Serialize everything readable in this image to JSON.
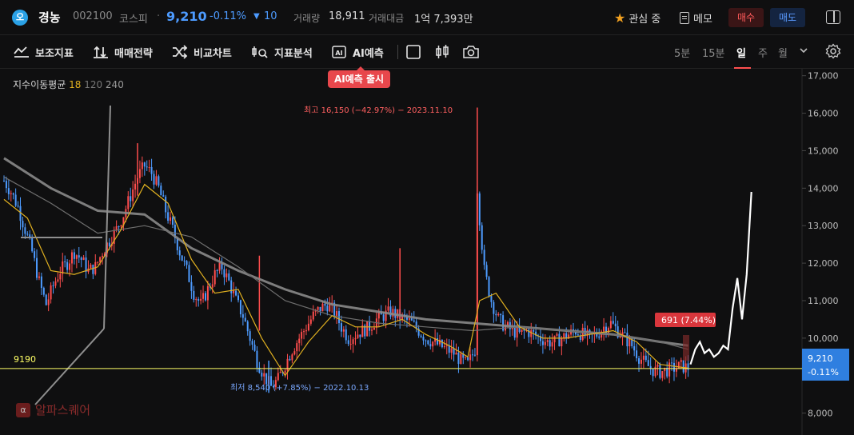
{
  "header": {
    "logo_glyph": "오",
    "name": "경농",
    "code": "002100",
    "market": "코스피",
    "dot": "·",
    "price": "9,210",
    "change_pct": "-0.11%",
    "change_arrow": "▼",
    "change_amt": "10",
    "volume_label": "거래량",
    "volume_value": "18,911",
    "tvalue_label": "거래대금",
    "tvalue_value": "1억 7,393만",
    "watch_label": "관심 중",
    "memo_label": "메모",
    "buy_label": "매수",
    "sell_label": "매도"
  },
  "toolbar": {
    "indicators": "보조지표",
    "strategy": "매매전략",
    "compare": "비교차트",
    "analysis": "지표분석",
    "ai_icon_text": "AI",
    "ai": "AI예측",
    "periods": [
      "5분",
      "15분",
      "일",
      "주",
      "월"
    ],
    "active_period": "일",
    "badge": "AI예측 출시"
  },
  "legend": {
    "label": "지수이동평균",
    "p1": "18",
    "p2": "120",
    "p3": "240"
  },
  "watermark": {
    "logo": "α",
    "text": "알파스퀘어"
  },
  "colors": {
    "up": "#ff4d4d",
    "down": "#4d9bff",
    "ma18": "#e0b020",
    "ma120": "#6e6e6e",
    "ma240": "#8a8a8a",
    "current_line": "#ffff66",
    "price_tag_bg": "#2f7fe0"
  },
  "chart_data": {
    "type": "candlestick",
    "ylim": [
      7800,
      17100
    ],
    "yticks": [
      "17,000",
      "16,000",
      "15,000",
      "14,000",
      "13,000",
      "12,000",
      "11,000",
      "10,000",
      "9,000",
      "8,000"
    ],
    "ytick_values": [
      17000,
      16000,
      15000,
      14000,
      13000,
      12000,
      11000,
      10000,
      9000,
      8000
    ],
    "current_price": 9210,
    "current_price_label": "9,210",
    "current_change_label": "-0.11%",
    "level_line": 9190,
    "level_line_label": "9190",
    "high_annotation": "최고 16,150 (−42.97%) − 2023.11.10",
    "low_annotation": "최저 8,540 (+7.85%) − 2022.10.13",
    "projection_label": "691  (7.44%)",
    "price_path": [
      [
        0,
        14200
      ],
      [
        3,
        13900
      ],
      [
        6,
        13500
      ],
      [
        9,
        12900
      ],
      [
        12,
        12300
      ],
      [
        15,
        11500
      ],
      [
        18,
        10900
      ],
      [
        21,
        11400
      ],
      [
        24,
        11800
      ],
      [
        27,
        12000
      ],
      [
        30,
        12300
      ],
      [
        33,
        12100
      ],
      [
        36,
        11800
      ],
      [
        39,
        11900
      ],
      [
        42,
        12300
      ],
      [
        45,
        12600
      ],
      [
        48,
        12900
      ],
      [
        51,
        13300
      ],
      [
        54,
        13800
      ],
      [
        57,
        14300
      ],
      [
        60,
        14600
      ],
      [
        63,
        14400
      ],
      [
        66,
        14000
      ],
      [
        69,
        13400
      ],
      [
        72,
        12900
      ],
      [
        75,
        12300
      ],
      [
        78,
        11800
      ],
      [
        81,
        11200
      ],
      [
        84,
        10900
      ],
      [
        87,
        11300
      ],
      [
        90,
        11700
      ],
      [
        93,
        11900
      ],
      [
        96,
        11500
      ],
      [
        99,
        11000
      ],
      [
        102,
        10600
      ],
      [
        105,
        10000
      ],
      [
        108,
        9400
      ],
      [
        111,
        9000
      ],
      [
        114,
        8700
      ],
      [
        117,
        8900
      ],
      [
        120,
        9300
      ],
      [
        123,
        9700
      ],
      [
        126,
        10000
      ],
      [
        129,
        10300
      ],
      [
        132,
        10600
      ],
      [
        135,
        10800
      ],
      [
        138,
        10900
      ],
      [
        141,
        10700
      ],
      [
        144,
        10300
      ],
      [
        147,
        10000
      ],
      [
        150,
        10100
      ],
      [
        153,
        10200
      ],
      [
        156,
        10300
      ],
      [
        159,
        10500
      ],
      [
        162,
        10600
      ],
      [
        165,
        10700
      ],
      [
        168,
        10600
      ],
      [
        171,
        10500
      ],
      [
        174,
        10400
      ],
      [
        177,
        10200
      ],
      [
        180,
        10000
      ],
      [
        183,
        9900
      ],
      [
        186,
        9800
      ],
      [
        189,
        9700
      ],
      [
        192,
        9600
      ],
      [
        195,
        9400
      ],
      [
        198,
        9300
      ],
      [
        201,
        9700
      ],
      [
        202,
        14000
      ],
      [
        203,
        13200
      ],
      [
        205,
        11800
      ],
      [
        208,
        11000
      ],
      [
        211,
        10500
      ],
      [
        214,
        10300
      ],
      [
        217,
        10200
      ],
      [
        220,
        10100
      ],
      [
        223,
        10200
      ],
      [
        226,
        10100
      ],
      [
        229,
        10000
      ],
      [
        232,
        9900
      ],
      [
        235,
        9900
      ],
      [
        238,
        10000
      ],
      [
        241,
        10100
      ],
      [
        244,
        10200
      ],
      [
        247,
        10100
      ],
      [
        250,
        10000
      ],
      [
        253,
        10100
      ],
      [
        256,
        10300
      ],
      [
        259,
        10400
      ],
      [
        262,
        10200
      ],
      [
        265,
        10000
      ],
      [
        268,
        9800
      ],
      [
        271,
        9500
      ],
      [
        274,
        9300
      ],
      [
        277,
        9150
      ],
      [
        280,
        9100
      ],
      [
        283,
        9150
      ],
      [
        286,
        9200
      ],
      [
        289,
        9250
      ],
      [
        292,
        9210
      ]
    ],
    "ma18_path": [
      [
        0,
        13700
      ],
      [
        10,
        13200
      ],
      [
        20,
        11800
      ],
      [
        30,
        11700
      ],
      [
        40,
        11900
      ],
      [
        50,
        12900
      ],
      [
        60,
        14100
      ],
      [
        70,
        13600
      ],
      [
        80,
        12100
      ],
      [
        90,
        11200
      ],
      [
        100,
        11300
      ],
      [
        110,
        10000
      ],
      [
        120,
        9000
      ],
      [
        130,
        9900
      ],
      [
        140,
        10600
      ],
      [
        150,
        10300
      ],
      [
        160,
        10300
      ],
      [
        170,
        10500
      ],
      [
        180,
        10100
      ],
      [
        190,
        9800
      ],
      [
        198,
        9500
      ],
      [
        203,
        11000
      ],
      [
        210,
        11200
      ],
      [
        220,
        10300
      ],
      [
        230,
        10000
      ],
      [
        240,
        10000
      ],
      [
        250,
        10100
      ],
      [
        260,
        10200
      ],
      [
        270,
        9900
      ],
      [
        280,
        9300
      ],
      [
        292,
        9200
      ]
    ],
    "ma120_path": [
      [
        0,
        14300
      ],
      [
        20,
        13600
      ],
      [
        40,
        12800
      ],
      [
        60,
        13000
      ],
      [
        80,
        12700
      ],
      [
        100,
        11900
      ],
      [
        120,
        11000
      ],
      [
        140,
        10600
      ],
      [
        160,
        10400
      ],
      [
        180,
        10300
      ],
      [
        200,
        10200
      ],
      [
        220,
        10300
      ],
      [
        240,
        10200
      ],
      [
        260,
        10100
      ],
      [
        280,
        9900
      ],
      [
        292,
        9700
      ]
    ],
    "ma240_path": [
      [
        0,
        14800
      ],
      [
        20,
        14000
      ],
      [
        40,
        13400
      ],
      [
        60,
        13300
      ],
      [
        80,
        12400
      ],
      [
        100,
        11800
      ],
      [
        120,
        11300
      ],
      [
        140,
        10900
      ],
      [
        160,
        10700
      ],
      [
        180,
        10500
      ],
      [
        200,
        10400
      ],
      [
        220,
        10300
      ],
      [
        240,
        10200
      ],
      [
        260,
        10100
      ],
      [
        280,
        9900
      ],
      [
        292,
        9800
      ]
    ],
    "forecast_path": [
      [
        293,
        9300
      ],
      [
        295,
        9700
      ],
      [
        297,
        9900
      ],
      [
        299,
        9600
      ],
      [
        301,
        9700
      ],
      [
        303,
        9500
      ],
      [
        305,
        9600
      ],
      [
        307,
        9800
      ],
      [
        309,
        9700
      ],
      [
        311,
        10800
      ],
      [
        313,
        11600
      ],
      [
        315,
        10500
      ],
      [
        317,
        11700
      ],
      [
        319,
        13900
      ]
    ]
  }
}
